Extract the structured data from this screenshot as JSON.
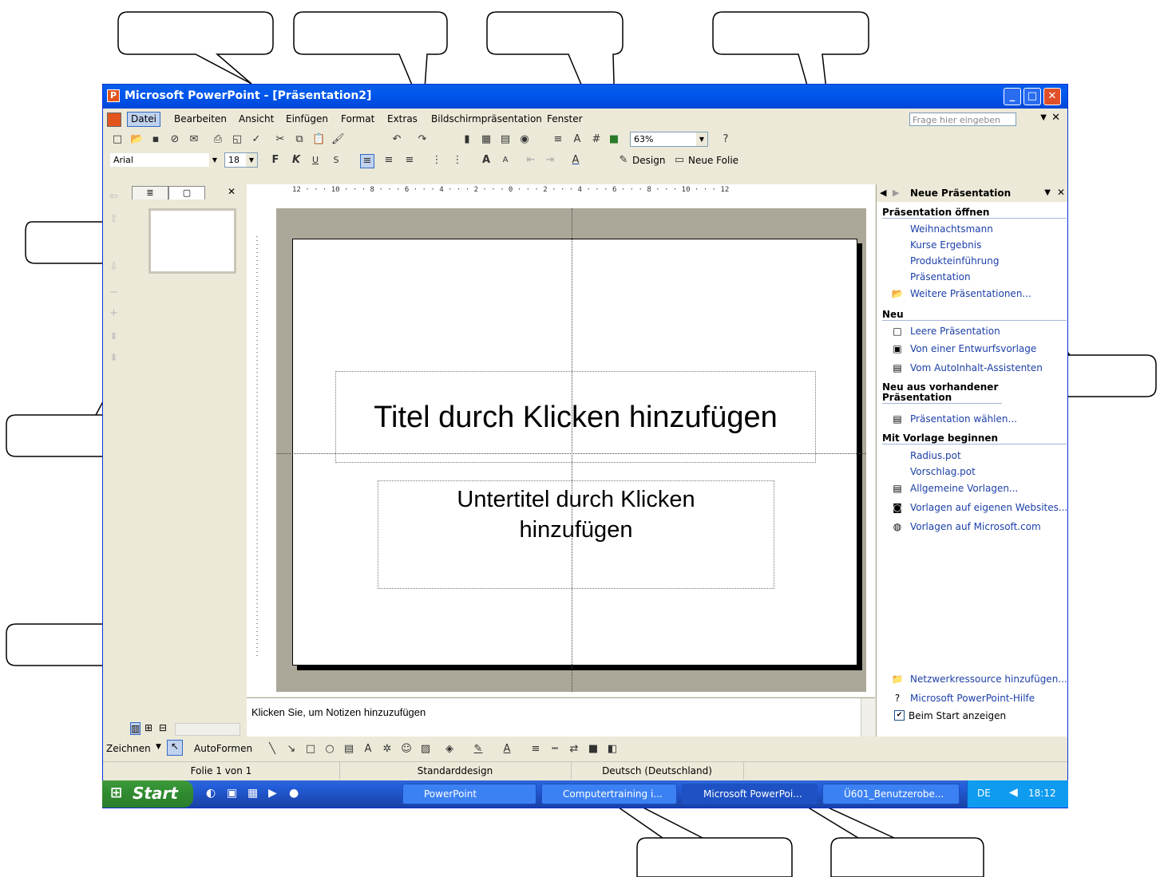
{
  "window": {
    "title": "Microsoft PowerPoint - [Präsentation2]",
    "app_icon": "powerpoint-icon",
    "controls": [
      "minimize",
      "maximize",
      "close"
    ]
  },
  "menu": {
    "items": [
      "Datei",
      "Bearbeiten",
      "Ansicht",
      "Einfügen",
      "Format",
      "Extras",
      "Bildschirmpräsentation",
      "Fenster"
    ],
    "help_box_placeholder": "Frage hier eingeben"
  },
  "standard_toolbar": {
    "zoom": "63%"
  },
  "format_toolbar": {
    "font": "Arial",
    "size": "18",
    "bold": "F",
    "italic": "K",
    "underline": "U",
    "shadow": "S",
    "design_label": "Design",
    "new_slide_label": "Neue Folie"
  },
  "slide": {
    "title_placeholder": "Titel durch Klicken hinzufügen",
    "subtitle_placeholder": "Untertitel durch Klicken hinzufügen"
  },
  "notes": {
    "placeholder": "Klicken Sie, um Notizen hinzuzufügen"
  },
  "drawing_toolbar": {
    "draw_label": "Zeichnen",
    "autoshapes_label": "AutoFormen"
  },
  "status": {
    "slide": "Folie 1 von 1",
    "design": "Standarddesign",
    "language": "Deutsch (Deutschland)"
  },
  "task_pane": {
    "title": "Neue Präsentation",
    "sections": {
      "open": "Präsentation öffnen",
      "new": "Neu",
      "from_existing": "Neu aus vorhandener Präsentation",
      "template": "Mit Vorlage beginnen"
    },
    "open_links": [
      "Weihnachtsmann",
      "Kurse Ergebnis",
      "Produkteinführung",
      "Präsentation",
      "Weitere Präsentationen..."
    ],
    "new_links": [
      "Leere Präsentation",
      "Von einer Entwurfsvorlage",
      "Vom AutoInhalt-Assistenten"
    ],
    "existing_links": [
      "Präsentation wählen..."
    ],
    "template_links": [
      "Radius.pot",
      "Vorschlag.pot",
      "Allgemeine Vorlagen...",
      "Vorlagen auf eigenen Websites...",
      "Vorlagen auf Microsoft.com"
    ],
    "bottom_links": [
      "Netzwerkressource hinzufügen...",
      "Microsoft PowerPoint-Hilfe"
    ],
    "show_at_start": "Beim Start anzeigen"
  },
  "taskbar": {
    "start": "Start",
    "items": [
      "PowerPoint",
      "Computertraining i...",
      "Microsoft PowerPoi...",
      "Ü601_Benutzerobe..."
    ],
    "lang": "DE",
    "time": "18:12"
  },
  "ruler": {
    "h_ticks": "12 · · · 10 · · · 8 · · · 6 · · · 4 · · · 2 · · · 0 · · · 2 · · · 4 · · · 6 · · · 8 · · · 10 · · · 12"
  }
}
